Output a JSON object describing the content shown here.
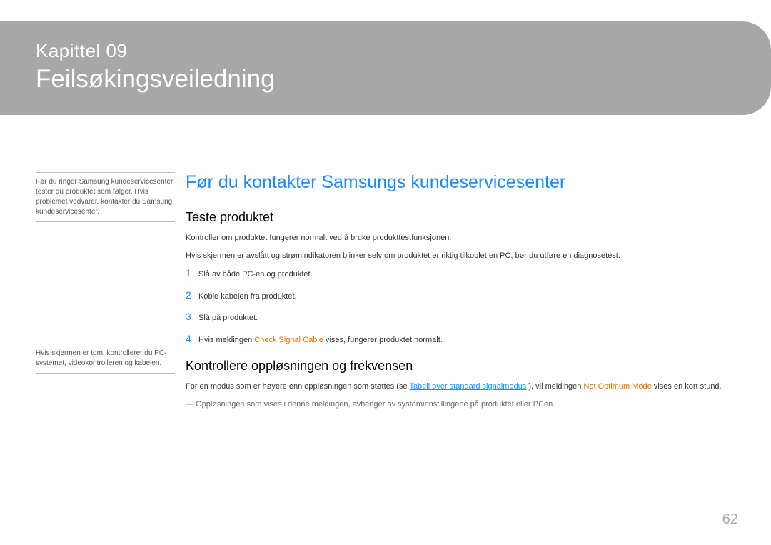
{
  "chapter": {
    "number_label": "Kapittel 09",
    "title": "Feilsøkingsveiledning"
  },
  "sidebar": {
    "note1": "Før du ringer Samsung kundeservicesenter tester du produktet som følger. Hvis problemet vedvarer, kontakter du Samsung kundeservicesenter.",
    "note2": "Hvis skjermen er tom, kontrollerer du PC-systemet, videokontrolleren og kabelen."
  },
  "section": {
    "title": "Før du kontakter Samsungs kundeservicesenter",
    "sub1": {
      "heading": "Teste produktet",
      "p1": "Kontroller om produktet fungerer normalt ved å bruke produkttestfunksjonen.",
      "p2": "Hvis skjermen er avslått og strømindikatoren blinker selv om produktet er riktig tilkoblet en PC, bør du utføre en diagnosetest.",
      "steps": [
        "Slå av både PC-en og produktet.",
        "Koble kabelen fra produktet.",
        "Slå på produktet."
      ],
      "step4_prefix": "Hvis meldingen ",
      "step4_highlight": "Check Signal Cable",
      "step4_suffix": " vises, fungerer produktet normalt."
    },
    "sub2": {
      "heading": "Kontrollere oppløsningen og frekvensen",
      "p_prefix": "For en modus som er høyere enn oppløsningen som støttes (se ",
      "p_link": "Tabell over standard signalmodus",
      "p_mid": " ), vil meldingen ",
      "p_highlight": "Not Optimum Mode",
      "p_suffix": " vises en kort stund.",
      "note": "Oppløsningen som vises i denne meldingen, avhenger av systeminnstillingene på produktet eller PCen."
    }
  },
  "page_number": "62"
}
